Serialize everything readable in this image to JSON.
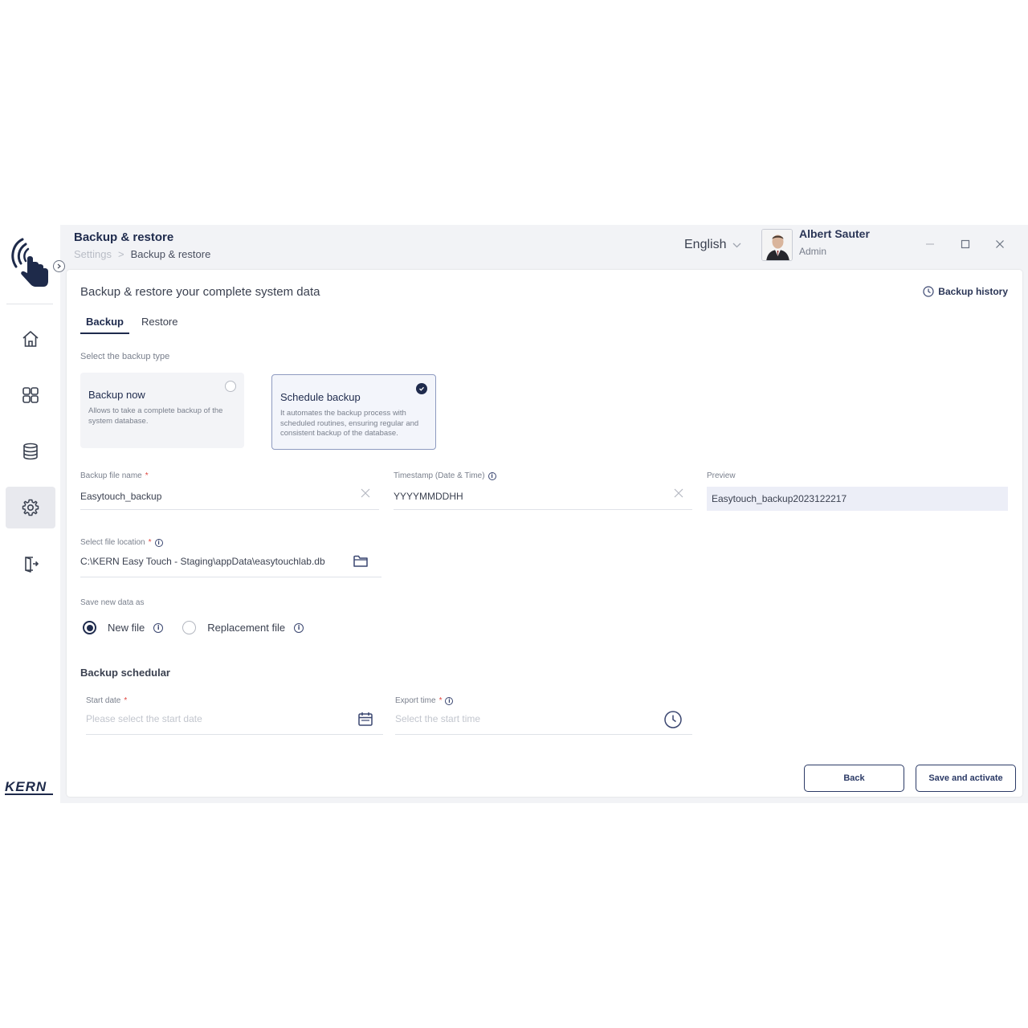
{
  "header": {
    "title": "Backup & restore",
    "breadcrumb_root": "Settings",
    "breadcrumb_separator": ">",
    "breadcrumb_current": "Backup & restore",
    "language": "English"
  },
  "user": {
    "name": "Albert Sauter",
    "role": "Admin"
  },
  "sidebar": {
    "items": [
      {
        "icon": "home-icon"
      },
      {
        "icon": "grid-icon"
      },
      {
        "icon": "database-icon"
      },
      {
        "icon": "gear-icon",
        "active": true
      },
      {
        "icon": "logout-icon"
      }
    ],
    "brand": "KERN"
  },
  "main": {
    "heading": "Backup & restore your complete system data",
    "history_link": "Backup history",
    "tabs": [
      {
        "label": "Backup",
        "active": true
      },
      {
        "label": "Restore",
        "active": false
      }
    ],
    "backup_type_label": "Select the backup type",
    "backup_types": [
      {
        "title": "Backup now",
        "description": "Allows to take a complete backup of the system database.",
        "selected": false
      },
      {
        "title": "Schedule backup",
        "description": "It automates the backup process with scheduled routines, ensuring regular and consistent backup of the database.",
        "selected": true
      }
    ],
    "file_name": {
      "label": "Backup file name",
      "required": "*",
      "value": "Easytouch_backup"
    },
    "timestamp": {
      "label": "Timestamp (Date & Time)",
      "value": "YYYYMMDDHH"
    },
    "preview": {
      "label": "Preview",
      "value": "Easytouch_backup2023122217"
    },
    "file_location": {
      "label": "Select file location",
      "required": "*",
      "value": "C:\\KERN Easy Touch - Staging\\appData\\easytouchlab.db"
    },
    "save_as": {
      "label": "Save new data as",
      "options": [
        {
          "label": "New file",
          "checked": true
        },
        {
          "label": "Replacement file",
          "checked": false
        }
      ]
    },
    "scheduler": {
      "heading": "Backup schedular",
      "start_date": {
        "label": "Start date",
        "required": "*",
        "placeholder": "Please select the start date"
      },
      "export_time": {
        "label": "Export time",
        "required": "*",
        "placeholder": "Select the start time"
      }
    },
    "buttons": {
      "back": "Back",
      "save": "Save and activate"
    }
  },
  "colors": {
    "primary": "#1f2b4d",
    "required": "#e0453e",
    "preview_bg": "#eceef7",
    "app_bg": "#f2f3f6"
  }
}
